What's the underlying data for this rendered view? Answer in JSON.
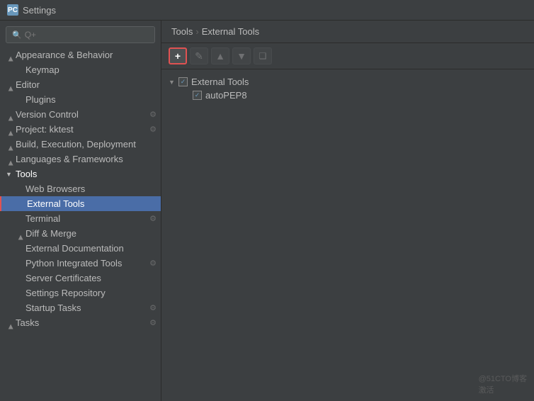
{
  "window": {
    "title": "Settings"
  },
  "search": {
    "placeholder": "Q+"
  },
  "breadcrumb": {
    "parent": "Tools",
    "separator": "›",
    "current": "External Tools"
  },
  "toolbar": {
    "add": "+",
    "edit": "✎",
    "up": "▲",
    "down": "▼",
    "copy": "❑"
  },
  "sidebar": {
    "items": [
      {
        "id": "appearance",
        "label": "Appearance & Behavior",
        "indent": 0,
        "hasArrow": true,
        "arrowDir": "right",
        "hasIcon": false
      },
      {
        "id": "keymap",
        "label": "Keymap",
        "indent": 1,
        "hasArrow": false,
        "hasIcon": false
      },
      {
        "id": "editor",
        "label": "Editor",
        "indent": 0,
        "hasArrow": true,
        "arrowDir": "right",
        "hasIcon": false
      },
      {
        "id": "plugins",
        "label": "Plugins",
        "indent": 1,
        "hasArrow": false,
        "hasIcon": false
      },
      {
        "id": "version-control",
        "label": "Version Control",
        "indent": 0,
        "hasArrow": true,
        "arrowDir": "right",
        "hasIcon": true
      },
      {
        "id": "project-kktest",
        "label": "Project: kktest",
        "indent": 0,
        "hasArrow": true,
        "arrowDir": "right",
        "hasIcon": true
      },
      {
        "id": "build-execution",
        "label": "Build, Execution, Deployment",
        "indent": 0,
        "hasArrow": true,
        "arrowDir": "right",
        "hasIcon": false
      },
      {
        "id": "languages-frameworks",
        "label": "Languages & Frameworks",
        "indent": 0,
        "hasArrow": true,
        "arrowDir": "right",
        "hasIcon": false
      },
      {
        "id": "tools",
        "label": "Tools",
        "indent": 0,
        "hasArrow": true,
        "arrowDir": "down",
        "hasIcon": false,
        "expanded": true
      },
      {
        "id": "web-browsers",
        "label": "Web Browsers",
        "indent": 1,
        "hasArrow": false,
        "hasIcon": false
      },
      {
        "id": "external-tools",
        "label": "External Tools",
        "indent": 1,
        "hasArrow": false,
        "hasIcon": false,
        "selected": true
      },
      {
        "id": "terminal",
        "label": "Terminal",
        "indent": 1,
        "hasArrow": false,
        "hasIcon": true
      },
      {
        "id": "diff-merge",
        "label": "Diff & Merge",
        "indent": 1,
        "hasArrow": true,
        "arrowDir": "right",
        "hasIcon": false
      },
      {
        "id": "external-documentation",
        "label": "External Documentation",
        "indent": 1,
        "hasArrow": false,
        "hasIcon": false
      },
      {
        "id": "python-integrated-tools",
        "label": "Python Integrated Tools",
        "indent": 1,
        "hasArrow": false,
        "hasIcon": true
      },
      {
        "id": "server-certificates",
        "label": "Server Certificates",
        "indent": 1,
        "hasArrow": false,
        "hasIcon": false
      },
      {
        "id": "settings-repository",
        "label": "Settings Repository",
        "indent": 1,
        "hasArrow": false,
        "hasIcon": false
      },
      {
        "id": "startup-tasks",
        "label": "Startup Tasks",
        "indent": 1,
        "hasArrow": false,
        "hasIcon": true
      },
      {
        "id": "tasks",
        "label": "Tasks",
        "indent": 0,
        "hasArrow": true,
        "arrowDir": "right",
        "hasIcon": true
      }
    ]
  },
  "content_tree": {
    "root": {
      "label": "External Tools",
      "checked": true,
      "children": [
        {
          "label": "autoPEP8",
          "checked": true
        }
      ]
    }
  },
  "watermark": "@51CTO博客\n激活"
}
